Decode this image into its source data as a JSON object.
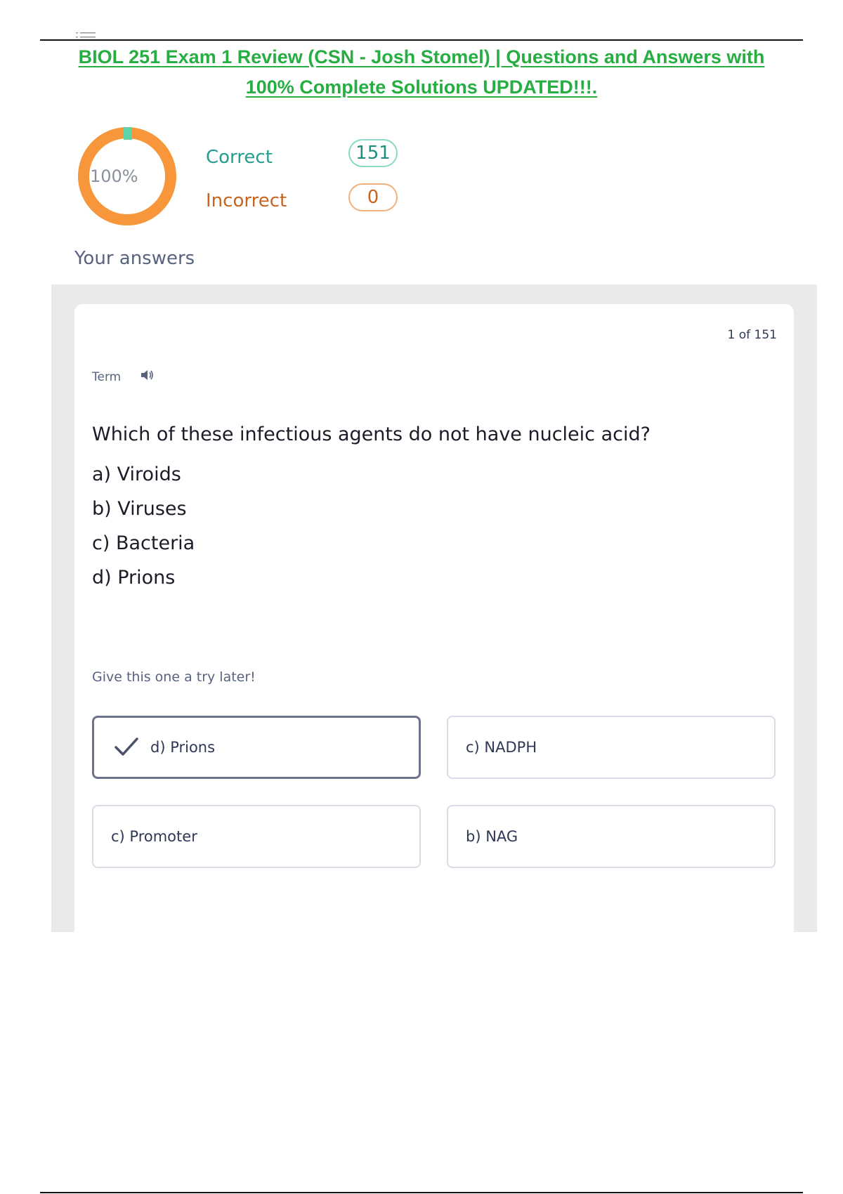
{
  "document": {
    "title": "BIOL 251 Exam 1 Review (CSN - Josh Stomel) | Questions and Answers with 100% Complete Solutions UPDATED!!!."
  },
  "score": {
    "percent_label": "100%",
    "percent_value": 100,
    "correct_label": "Correct",
    "correct_count": "151",
    "incorrect_label": "Incorrect",
    "incorrect_count": "0",
    "colors": {
      "ring": "#f7963a",
      "marker": "#5fd3a8",
      "correct": "#23a08d",
      "incorrect": "#c8641c"
    }
  },
  "answers_heading": "Your answers",
  "card": {
    "counter": "1 of 151",
    "term_label": "Term",
    "audio_icon": "speaker-icon",
    "question": "Which of these infectious agents do not have nucleic acid?",
    "options": [
      "a) Viroids",
      "b) Viruses",
      "c) Bacteria",
      "d) Prions"
    ],
    "hint": "Give this one a try later!",
    "choices": [
      {
        "label": "d) Prions",
        "selected": true
      },
      {
        "label": "c) NADPH",
        "selected": false
      },
      {
        "label": "c) Promoter",
        "selected": false
      },
      {
        "label": "b) NAG",
        "selected": false
      }
    ]
  }
}
